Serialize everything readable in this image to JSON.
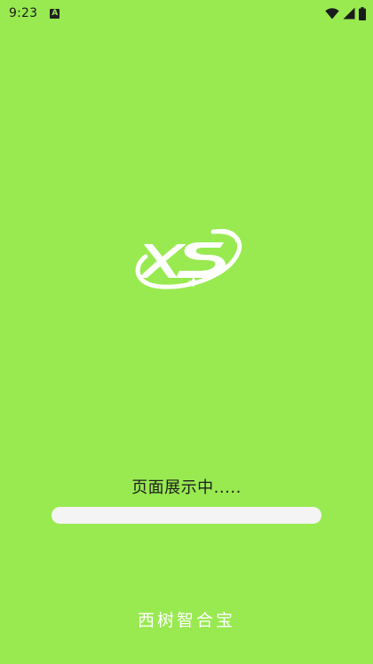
{
  "status_bar": {
    "time": "9:23",
    "notification_icon": "A",
    "icons": [
      "wifi-icon",
      "cellular-signal-icon",
      "battery-icon"
    ]
  },
  "splash": {
    "logo_icon": "xs-logo-icon",
    "loading_text": "页面展示中.....",
    "progress": 0,
    "app_name": "西树智合宝"
  },
  "colors": {
    "background": "#98ea50",
    "progress_track": "#f4f4f4",
    "text_dark": "#1e1e1e",
    "text_light": "#ffffff"
  }
}
